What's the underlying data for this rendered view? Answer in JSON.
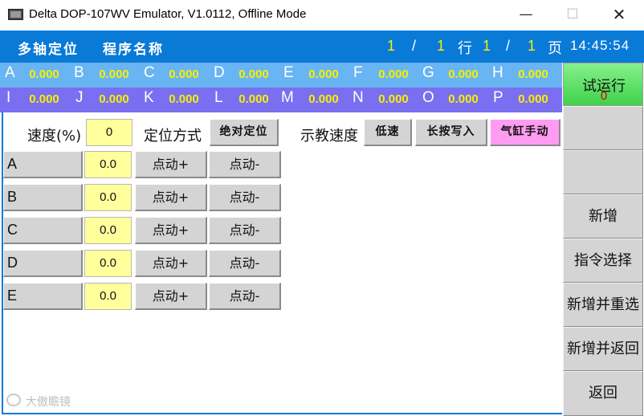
{
  "window": {
    "title": "Delta DOP-107WV Emulator, V1.0112, Offline Mode",
    "minimize_glyph": "—",
    "maximize_glyph": "☐",
    "close_glyph": "✕"
  },
  "header": {
    "label_multiaxis": "多轴定位",
    "label_program": "程序名称",
    "row_current": "1",
    "row_sep": "/",
    "row_total": "1",
    "row_unit": "行",
    "page_current": "1",
    "page_sep": "/",
    "page_total": "1",
    "page_unit": "页",
    "clock": "14:45:54"
  },
  "axes_row1": [
    {
      "name": "A",
      "value": "0.000"
    },
    {
      "name": "B",
      "value": "0.000"
    },
    {
      "name": "C",
      "value": "0.000"
    },
    {
      "name": "D",
      "value": "0.000"
    },
    {
      "name": "E",
      "value": "0.000"
    },
    {
      "name": "F",
      "value": "0.000"
    },
    {
      "name": "G",
      "value": "0.000"
    },
    {
      "name": "H",
      "value": "0.000"
    }
  ],
  "axes_row2": [
    {
      "name": "I",
      "value": "0.000"
    },
    {
      "name": "J",
      "value": "0.000"
    },
    {
      "name": "K",
      "value": "0.000"
    },
    {
      "name": "L",
      "value": "0.000"
    },
    {
      "name": "M",
      "value": "0.000"
    },
    {
      "name": "N",
      "value": "0.000"
    },
    {
      "name": "O",
      "value": "0.000"
    },
    {
      "name": "P",
      "value": "0.000"
    }
  ],
  "controls": {
    "speed_label": "速度(%)",
    "speed_value": "0",
    "positioning_label": "定位方式",
    "positioning_mode": "绝对定位",
    "teach_speed_label": "示教速度",
    "teach_speed_value": "低速",
    "long_press_write": "长按写入",
    "cylinder_manual": "气缸手动"
  },
  "axis_jog": [
    {
      "axis": "A",
      "value": "0.0",
      "jog_plus": "点动+",
      "jog_minus": "点动-"
    },
    {
      "axis": "B",
      "value": "0.0",
      "jog_plus": "点动+",
      "jog_minus": "点动-"
    },
    {
      "axis": "C",
      "value": "0.0",
      "jog_plus": "点动+",
      "jog_minus": "点动-"
    },
    {
      "axis": "D",
      "value": "0.0",
      "jog_plus": "点动+",
      "jog_minus": "点动-"
    },
    {
      "axis": "E",
      "value": "0.0",
      "jog_plus": "点动+",
      "jog_minus": "点动-"
    }
  ],
  "sidebar": {
    "trial_run": "试运行",
    "trial_run_count": "0",
    "add_new": "新增",
    "command_select": "指令选择",
    "add_reselect": "新增并重选",
    "add_return": "新增并返回",
    "back": "返回"
  },
  "watermark": {
    "text": "大傲瞻镜"
  },
  "colors": {
    "header_blue": "#0a7ad7",
    "row1_blue": "#69b4f2",
    "row2_purple": "#7a6ff0",
    "value_yellow": "#f6f000",
    "input_yellow": "#ffff9c",
    "trial_green": "#3fd24a",
    "cylinder_pink": "#ff9cf2"
  }
}
